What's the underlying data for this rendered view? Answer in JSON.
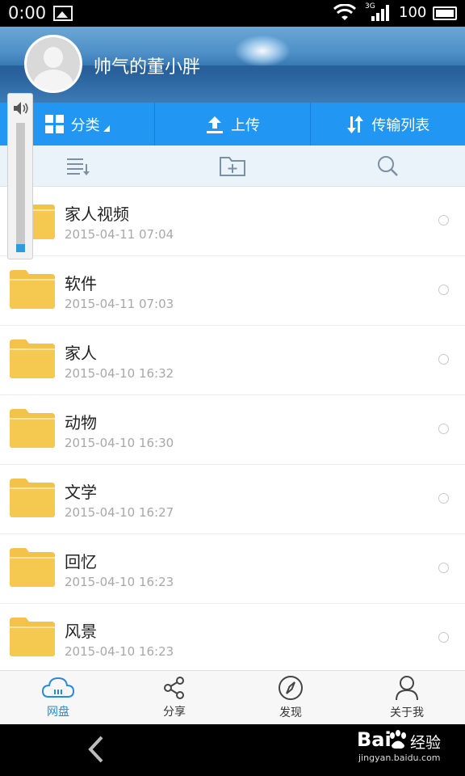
{
  "status_bar": {
    "time": "0:00",
    "network": "3G",
    "battery": "100"
  },
  "header": {
    "username": "帅气的董小胖"
  },
  "actions": [
    {
      "label": "分类",
      "icon": "grid-icon"
    },
    {
      "label": "上传",
      "icon": "upload-icon"
    },
    {
      "label": "传输列表",
      "icon": "transfer-icon"
    }
  ],
  "toolbar": {
    "icons": [
      "sort-list-icon",
      "new-folder-icon",
      "search-icon"
    ]
  },
  "files": [
    {
      "name": "家人视频",
      "date": "2015-04-11  07:04"
    },
    {
      "name": "软件",
      "date": "2015-04-11  07:03"
    },
    {
      "name": "家人",
      "date": "2015-04-10  16:32"
    },
    {
      "name": "动物",
      "date": "2015-04-10  16:30"
    },
    {
      "name": "文学",
      "date": "2015-04-10  16:27"
    },
    {
      "name": "回忆",
      "date": "2015-04-10  16:23"
    },
    {
      "name": "风景",
      "date": "2015-04-10  16:23"
    }
  ],
  "volume": {
    "level": 0.06
  },
  "tabs": [
    {
      "label": "网盘",
      "icon": "cloud-icon",
      "active": true
    },
    {
      "label": "分享",
      "icon": "share-icon",
      "active": false
    },
    {
      "label": "发现",
      "icon": "compass-icon",
      "active": false
    },
    {
      "label": "关于我",
      "icon": "person-icon",
      "active": false
    }
  ],
  "watermark": {
    "brand": "Bai",
    "brand_cn": "经验",
    "url": "jingyan.baidu.com"
  },
  "colors": {
    "accent": "#2196f3",
    "folder": "#f2c24b",
    "tab_active": "#2b8ad8"
  }
}
